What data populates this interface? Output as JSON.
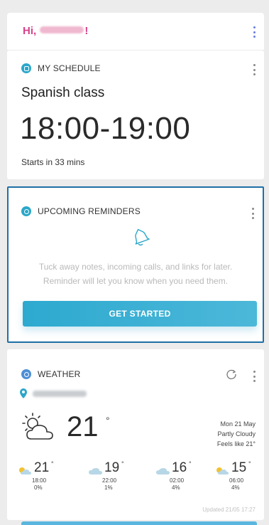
{
  "greeting": {
    "prefix": "Hi,",
    "suffix": "!"
  },
  "schedule": {
    "header": "MY SCHEDULE",
    "title": "Spanish class",
    "time": "18:00-19:00",
    "starts_in": "Starts in 33 mins",
    "icon_color": "#2ba7c9"
  },
  "reminders": {
    "header": "UPCOMING REMINDERS",
    "line1": "Tuck away notes, incoming calls, and links for later.",
    "line2": "Reminder will let you know when you need them.",
    "button": "GET STARTED",
    "icon_color": "#2ba7c9",
    "focus_border": "#1f6fa6"
  },
  "weather": {
    "header": "WEATHER",
    "icon_color": "#4e8fd6",
    "current_temp": "21",
    "degree_symbol": "°",
    "date": "Mon 21 May",
    "condition": "Partly Cloudy",
    "feels_like": "Feels like 21°",
    "current_icon": "partly-cloudy-icon",
    "forecast": [
      {
        "temp": "21",
        "time": "18:00",
        "rain": "0%",
        "icon": "sun-cloud-icon"
      },
      {
        "temp": "19",
        "time": "22:00",
        "rain": "1%",
        "icon": "cloud-icon"
      },
      {
        "temp": "16",
        "time": "02:00",
        "rain": "4%",
        "icon": "cloud-icon"
      },
      {
        "temp": "15",
        "time": "06:00",
        "rain": "4%",
        "icon": "sun-cloud-icon"
      }
    ],
    "updated": "Updated 21/05 17:27"
  }
}
